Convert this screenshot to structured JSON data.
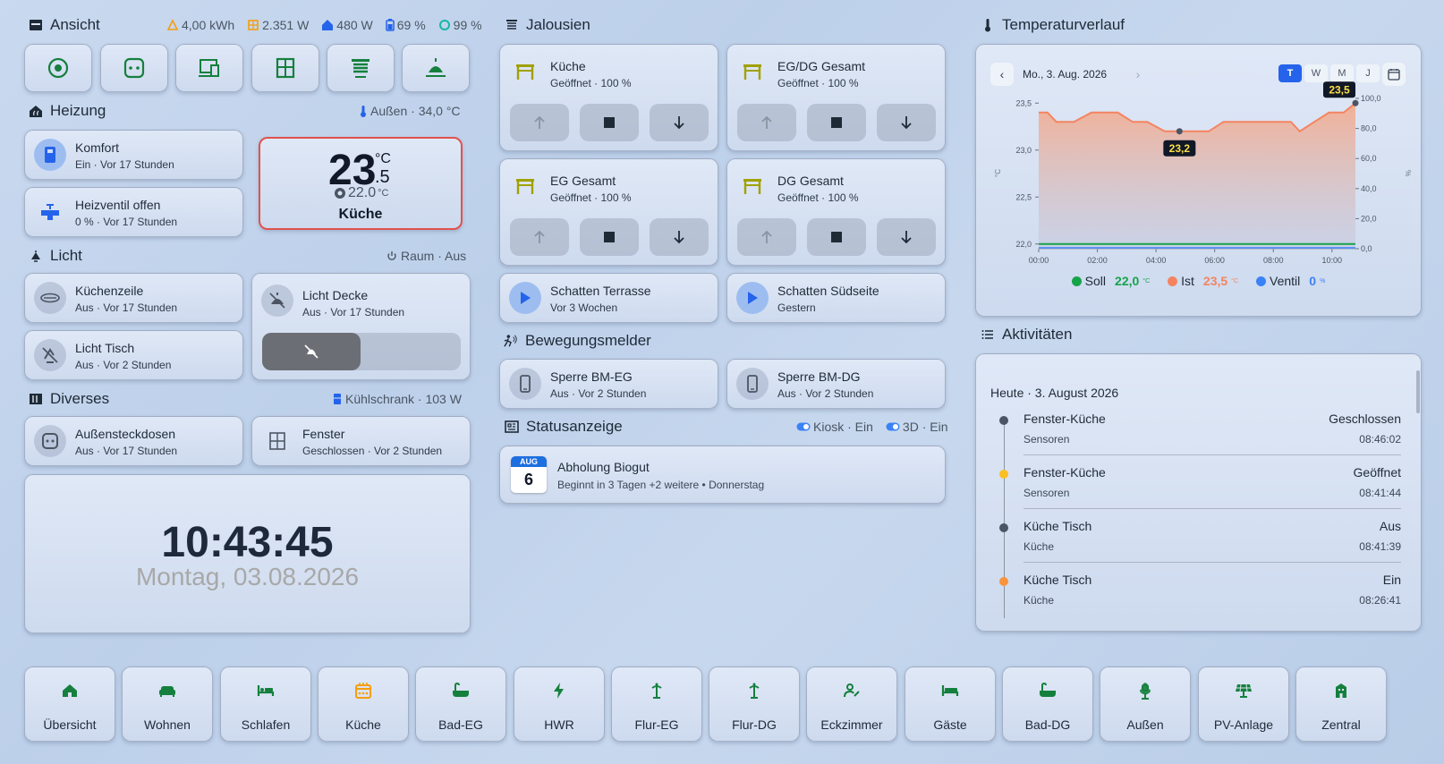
{
  "ansicht": {
    "title": "Ansicht",
    "status": [
      {
        "icon": "solar-icon",
        "value": "4,00 kWh",
        "color": "#f59e0b"
      },
      {
        "icon": "power-icon",
        "value": "2.351 W",
        "color": "#f59e0b"
      },
      {
        "icon": "home-power-icon",
        "value": "480 W",
        "color": "#2563eb"
      },
      {
        "icon": "battery-icon",
        "value": "69 %",
        "color": "#2563eb"
      },
      {
        "icon": "autarky-icon",
        "value": "99 %",
        "color": "#14b8a6"
      }
    ],
    "buttons": [
      "eye-icon",
      "socket-icon",
      "devices-icon",
      "window-icon",
      "blinds-icon",
      "ceiling-light-icon"
    ]
  },
  "heizung": {
    "title": "Heizung",
    "outside_label": "Außen · 34,0 °C",
    "komfort": {
      "title": "Komfort",
      "sub": "Ein · Vor 17 Stunden"
    },
    "ventil": {
      "title": "Heizventil offen",
      "sub": "0 % · Vor 17 Stunden"
    },
    "thermo": {
      "temp_int": "23",
      "temp_unit": "°C",
      "temp_dec": ".5",
      "target": "22.0",
      "target_unit": "°C",
      "room": "Küche"
    }
  },
  "licht": {
    "title": "Licht",
    "right_label": "Raum · Aus",
    "kuechenzeile": {
      "title": "Küchenzeile",
      "sub": "Aus · Vor 17 Stunden"
    },
    "decke": {
      "title": "Licht Decke",
      "sub": "Aus · Vor 17 Stunden"
    },
    "tisch": {
      "title": "Licht Tisch",
      "sub": "Aus · Vor 2 Stunden"
    }
  },
  "diverses": {
    "title": "Diverses",
    "right_label": "Kühlschrank · 103 W",
    "steckdosen": {
      "title": "Außensteckdosen",
      "sub": "Aus · Vor 17 Stunden"
    },
    "fenster": {
      "title": "Fenster",
      "sub": "Geschlossen · Vor 2 Stunden"
    }
  },
  "clock": {
    "time": "10:43:45",
    "date": "Montag, 03.08.2026"
  },
  "jalousien": {
    "title": "Jalousien",
    "items": [
      {
        "title": "Küche",
        "sub": "Geöffnet · 100 %"
      },
      {
        "title": "EG/DG Gesamt",
        "sub": "Geöffnet · 100 %"
      },
      {
        "title": "EG Gesamt",
        "sub": "Geöffnet · 100 %"
      },
      {
        "title": "DG Gesamt",
        "sub": "Geöffnet · 100 %"
      }
    ],
    "scenes": [
      {
        "title": "Schatten Terrasse",
        "sub": "Vor 3 Wochen"
      },
      {
        "title": "Schatten Südseite",
        "sub": "Gestern"
      }
    ]
  },
  "bewegung": {
    "title": "Bewegungsmelder",
    "items": [
      {
        "title": "Sperre BM-EG",
        "sub": "Aus · Vor 2 Stunden"
      },
      {
        "title": "Sperre BM-DG",
        "sub": "Aus · Vor 2 Stunden"
      }
    ]
  },
  "statusanzeige": {
    "title": "Statusanzeige",
    "kiosk": "Kiosk · Ein",
    "three_d": "3D · Ein",
    "event": {
      "month": "AUG",
      "day": "6",
      "title": "Abholung Biogut",
      "sub": "Beginnt in 3 Tagen +2 weitere • Donnerstag"
    }
  },
  "temperatur": {
    "title": "Temperaturverlauf",
    "date": "Mo., 3. Aug. 2026",
    "ranges": [
      "T",
      "W",
      "M",
      "J"
    ],
    "active_range": "T",
    "tooltip_min": "23,2",
    "tooltip_max": "23,5",
    "legend": [
      {
        "name": "Soll",
        "value": "22,0",
        "unit": "°C",
        "color": "#16a34a"
      },
      {
        "name": "Ist",
        "value": "23,5",
        "unit": "°C",
        "color": "#f4845f"
      },
      {
        "name": "Ventil",
        "value": "0",
        "unit": "%",
        "color": "#3b82f6"
      }
    ]
  },
  "chart_data": {
    "type": "line",
    "xlabel": "",
    "ylabel": "°C",
    "y2label": "%",
    "x_ticks": [
      "00:00",
      "02:00",
      "04:00",
      "06:00",
      "08:00",
      "10:00"
    ],
    "y_ticks": [
      "22,0",
      "22,5",
      "23,0",
      "23,5"
    ],
    "y2_ticks": [
      "0,0",
      "20,0",
      "40,0",
      "60,0",
      "80,0",
      "100,0"
    ],
    "ylim": [
      21.95,
      23.55
    ],
    "y2lim": [
      0,
      100
    ],
    "xlim": [
      0,
      10.8
    ],
    "series": [
      {
        "name": "Ist",
        "color": "#f4845f",
        "x": [
          0,
          0.3,
          0.6,
          1.2,
          1.8,
          2.3,
          2.7,
          3.2,
          3.7,
          4.3,
          4.7,
          5.3,
          5.8,
          6.3,
          7.1,
          7.8,
          8.6,
          8.9,
          9.4,
          9.9,
          10.4,
          10.8
        ],
        "y": [
          23.4,
          23.4,
          23.3,
          23.3,
          23.4,
          23.4,
          23.4,
          23.3,
          23.3,
          23.2,
          23.2,
          23.2,
          23.2,
          23.3,
          23.3,
          23.3,
          23.3,
          23.2,
          23.3,
          23.4,
          23.4,
          23.5
        ]
      },
      {
        "name": "Soll",
        "color": "#16a34a",
        "x": [
          0,
          10.8
        ],
        "y": [
          22.0,
          22.0
        ]
      },
      {
        "name": "Ventil",
        "color": "#3b82f6",
        "x": [
          0,
          10.8
        ],
        "y": [
          0,
          0
        ]
      }
    ],
    "annotations": [
      {
        "x": 4.8,
        "y": 23.2,
        "label": "23,2"
      },
      {
        "x": 10.8,
        "y": 23.5,
        "label": "23,5"
      }
    ]
  },
  "aktivitaeten": {
    "title": "Aktivitäten",
    "day_label": "Heute · 3. August 2026",
    "items": [
      {
        "title": "Fenster-Küche",
        "sub": "Sensoren",
        "state": "Geschlossen",
        "time": "08:46:02",
        "color": "#4b5563"
      },
      {
        "title": "Fenster-Küche",
        "sub": "Sensoren",
        "state": "Geöffnet",
        "time": "08:41:44",
        "color": "#fbbf24"
      },
      {
        "title": "Küche Tisch",
        "sub": "Küche",
        "state": "Aus",
        "time": "08:41:39",
        "color": "#4b5563"
      },
      {
        "title": "Küche Tisch",
        "sub": "Küche",
        "state": "Ein",
        "time": "08:26:41",
        "color": "#fb923c"
      }
    ]
  },
  "nav": [
    {
      "label": "Übersicht",
      "icon": "home-icon"
    },
    {
      "label": "Wohnen",
      "icon": "sofa-icon"
    },
    {
      "label": "Schlafen",
      "icon": "bed-icon"
    },
    {
      "label": "Küche",
      "icon": "stove-icon",
      "active": true
    },
    {
      "label": "Bad-EG",
      "icon": "bathtub-icon"
    },
    {
      "label": "HWR",
      "icon": "lightning-icon"
    },
    {
      "label": "Flur-EG",
      "icon": "coat-rack-icon"
    },
    {
      "label": "Flur-DG",
      "icon": "coat-rack-icon"
    },
    {
      "label": "Eckzimmer",
      "icon": "desk-icon"
    },
    {
      "label": "Gäste",
      "icon": "guest-bed-icon"
    },
    {
      "label": "Bad-DG",
      "icon": "bathtub-icon"
    },
    {
      "label": "Außen",
      "icon": "flower-icon"
    },
    {
      "label": "PV-Anlage",
      "icon": "solar-panel-icon"
    },
    {
      "label": "Zentral",
      "icon": "building-icon"
    }
  ]
}
